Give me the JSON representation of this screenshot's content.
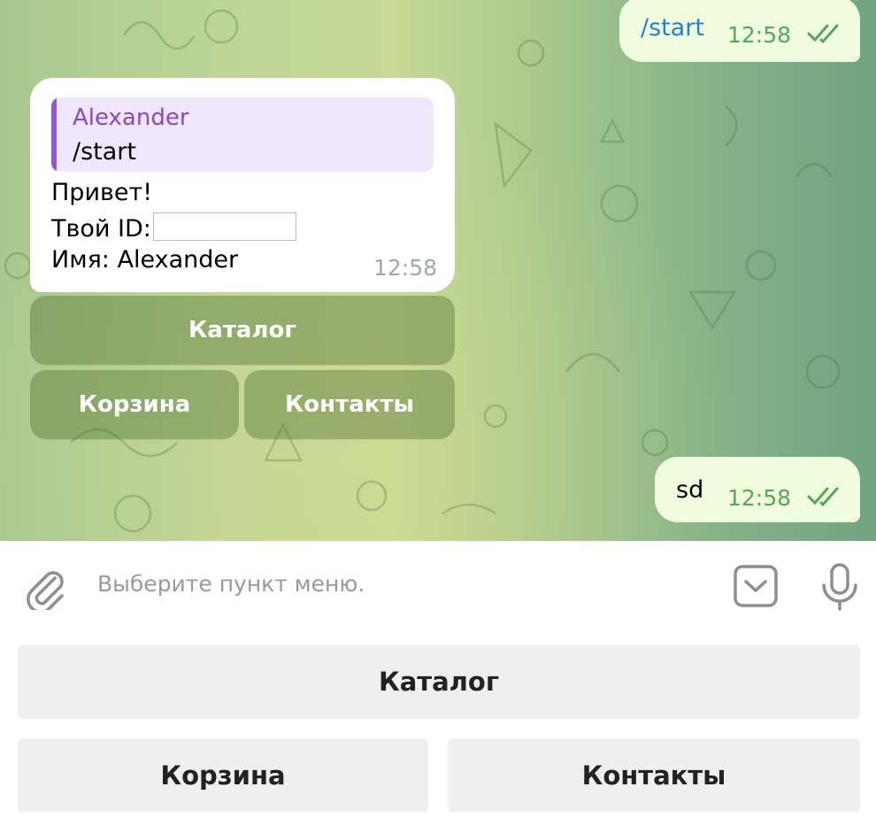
{
  "chat": {
    "messages": {
      "start_cmd": {
        "text": "/start",
        "time": "12:58",
        "status": "read"
      },
      "bot_reply": {
        "reply_to_name": "Alexander",
        "reply_to_text": "/start",
        "line1": "Привет!",
        "line2_label": "Твой ID:",
        "line3": "Имя: Alexander",
        "time": "12:58"
      },
      "sd_msg": {
        "text": "sd",
        "time": "12:58",
        "status": "read"
      }
    },
    "inline_keyboard": {
      "catalog": "Каталог",
      "cart": "Корзина",
      "contacts": "Контакты"
    }
  },
  "composer": {
    "placeholder": "Выберите пункт меню.",
    "icons": {
      "attach": "paperclip-icon",
      "keyboard": "keyboard-toggle-icon",
      "mic": "microphone-icon"
    }
  },
  "reply_keyboard": {
    "catalog": "Каталог",
    "cart": "Корзина",
    "contacts": "Контакты"
  },
  "colors": {
    "outgoing_bubble": "#effdde",
    "outgoing_time": "#5aa55a",
    "command_link": "#2481cc",
    "reply_accent": "#9555d8",
    "reply_name": "#8a46d3"
  }
}
